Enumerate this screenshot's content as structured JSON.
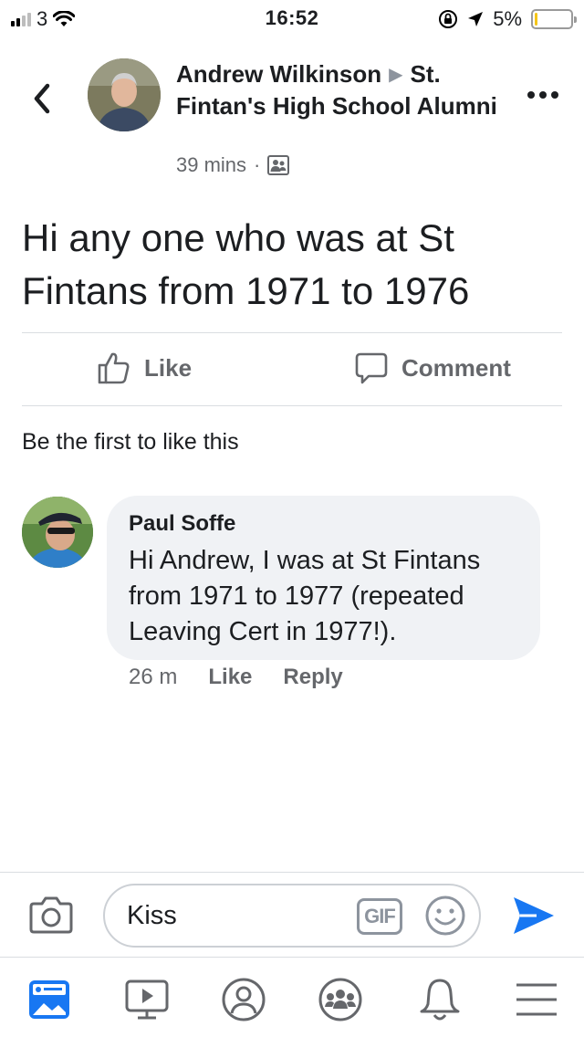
{
  "status_bar": {
    "carrier": "3",
    "time": "16:52",
    "battery_percent": "5%",
    "battery_level": 0.05,
    "signal_bars_active": 2
  },
  "header": {
    "author": "Andrew Wilkinson",
    "group": "St. Fintan's High School Alumni",
    "time_ago": "39 mins",
    "separator": "·",
    "privacy_icon": "group-members-icon"
  },
  "post": {
    "text": "Hi any one who was at St Fintans from 1971 to 1976"
  },
  "actions": {
    "like_label": "Like",
    "comment_label": "Comment"
  },
  "likes_summary": "Be the first to like this",
  "comment": {
    "author": "Paul Soffe",
    "text": "Hi Andrew, I was at St Fintans from 1971 to 1977 (repeated Leaving Cert in 1977!).",
    "time": "26 m",
    "like_label": "Like",
    "reply_label": "Reply"
  },
  "composer": {
    "value": "Kiss",
    "gif_label": "GIF"
  },
  "colors": {
    "accent": "#1877f2",
    "secondary_text": "#65676b",
    "bubble_bg": "#f0f2f5",
    "battery_low": "#f5c518"
  },
  "tabbar": {
    "tabs": [
      "news-feed-icon",
      "watch-icon",
      "profile-icon",
      "groups-icon",
      "notifications-icon",
      "menu-icon"
    ]
  }
}
